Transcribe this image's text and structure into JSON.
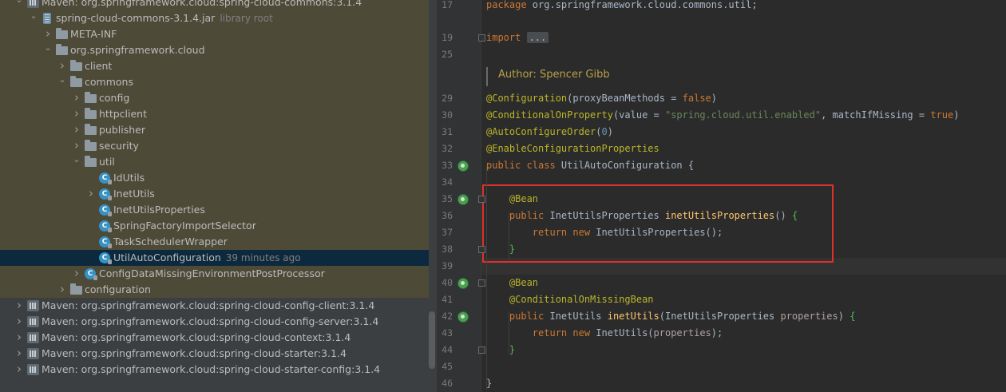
{
  "tree": {
    "rows": [
      {
        "label": "Maven: org.springframework.cloud:spring-cloud-commons:3.1.4",
        "meta": "",
        "icon": "maven",
        "arrow": "down"
      },
      {
        "label": "spring-cloud-commons-3.1.4.jar",
        "meta": "library root",
        "icon": "jar",
        "arrow": "down"
      },
      {
        "label": "META-INF",
        "meta": "",
        "icon": "folder",
        "arrow": "right"
      },
      {
        "label": "org.springframework.cloud",
        "meta": "",
        "icon": "folder",
        "arrow": "down"
      },
      {
        "label": "client",
        "meta": "",
        "icon": "folder",
        "arrow": "right"
      },
      {
        "label": "commons",
        "meta": "",
        "icon": "folder",
        "arrow": "down"
      },
      {
        "label": "config",
        "meta": "",
        "icon": "folder",
        "arrow": "right"
      },
      {
        "label": "httpclient",
        "meta": "",
        "icon": "folder",
        "arrow": "right"
      },
      {
        "label": "publisher",
        "meta": "",
        "icon": "folder",
        "arrow": "right"
      },
      {
        "label": "security",
        "meta": "",
        "icon": "folder",
        "arrow": "right"
      },
      {
        "label": "util",
        "meta": "",
        "icon": "folder",
        "arrow": "down"
      },
      {
        "label": "IdUtils",
        "meta": "",
        "icon": "class",
        "arrow": ""
      },
      {
        "label": "InetUtils",
        "meta": "",
        "icon": "class",
        "arrow": "right"
      },
      {
        "label": "InetUtilsProperties",
        "meta": "",
        "icon": "class",
        "arrow": ""
      },
      {
        "label": "SpringFactoryImportSelector",
        "meta": "",
        "icon": "class",
        "arrow": ""
      },
      {
        "label": "TaskSchedulerWrapper",
        "meta": "",
        "icon": "class",
        "arrow": ""
      },
      {
        "label": "UtilAutoConfiguration",
        "meta": "39 minutes ago",
        "icon": "class",
        "arrow": ""
      },
      {
        "label": "ConfigDataMissingEnvironmentPostProcessor",
        "meta": "",
        "icon": "class",
        "arrow": "right"
      },
      {
        "label": "configuration",
        "meta": "",
        "icon": "folder",
        "arrow": "right"
      },
      {
        "label": "Maven: org.springframework.cloud:spring-cloud-config-client:3.1.4",
        "meta": "",
        "icon": "maven",
        "arrow": "right"
      },
      {
        "label": "Maven: org.springframework.cloud:spring-cloud-config-server:3.1.4",
        "meta": "",
        "icon": "maven",
        "arrow": "right"
      },
      {
        "label": "Maven: org.springframework.cloud:spring-cloud-context:3.1.4",
        "meta": "",
        "icon": "maven",
        "arrow": "right"
      },
      {
        "label": "Maven: org.springframework.cloud:spring-cloud-starter:3.1.4",
        "meta": "",
        "icon": "maven",
        "arrow": "right"
      },
      {
        "label": "Maven: org.springframework.cloud:spring-cloud-starter-config:3.1.4",
        "meta": "",
        "icon": "maven",
        "arrow": "right"
      }
    ],
    "selected_label": "UtilAutoConfiguration"
  },
  "editor": {
    "author_hint": "Author: Spencer Gibb",
    "lines": [
      {
        "n": "17",
        "tokens": [
          [
            "kw",
            "package "
          ],
          [
            "par",
            "org.springframework.cloud.commons.util;"
          ]
        ]
      },
      {
        "n": "19",
        "tokens": [
          [
            "kw",
            "import "
          ],
          [
            "folded",
            "..."
          ]
        ]
      },
      {
        "n": "25",
        "tokens": []
      },
      {
        "n": "29",
        "tokens": [
          [
            "an",
            "@Configuration"
          ],
          [
            "par",
            "(proxyBeanMethods = "
          ],
          [
            "kw",
            "false"
          ],
          [
            "par",
            ")"
          ]
        ]
      },
      {
        "n": "30",
        "tokens": [
          [
            "an",
            "@ConditionalOnProperty"
          ],
          [
            "par",
            "(value = "
          ],
          [
            "st",
            "\"spring.cloud.util.enabled\""
          ],
          [
            "par",
            ", matchIfMissing = "
          ],
          [
            "kw",
            "true"
          ],
          [
            "par",
            ")"
          ]
        ]
      },
      {
        "n": "31",
        "tokens": [
          [
            "an",
            "@AutoConfigureOrder"
          ],
          [
            "par",
            "("
          ],
          [
            "num",
            "0"
          ],
          [
            "par",
            ")"
          ]
        ]
      },
      {
        "n": "32",
        "tokens": [
          [
            "an",
            "@EnableConfigurationProperties"
          ]
        ]
      },
      {
        "n": "33",
        "tokens": [
          [
            "kw",
            "public class "
          ],
          [
            "par",
            "UtilAutoConfiguration {"
          ]
        ]
      },
      {
        "n": "34",
        "tokens": []
      },
      {
        "n": "35",
        "tokens": [
          [
            "par",
            "    "
          ],
          [
            "an",
            "@Bean"
          ]
        ]
      },
      {
        "n": "36",
        "tokens": [
          [
            "par",
            "    "
          ],
          [
            "kw",
            "public "
          ],
          [
            "par",
            "InetUtilsProperties "
          ],
          [
            "fn",
            "inetUtilsProperties"
          ],
          [
            "par",
            "() "
          ],
          [
            "br-g",
            "{"
          ]
        ]
      },
      {
        "n": "37",
        "tokens": [
          [
            "par",
            "        "
          ],
          [
            "kw",
            "return new "
          ],
          [
            "par",
            "InetUtilsProperties();"
          ]
        ]
      },
      {
        "n": "38",
        "tokens": [
          [
            "par",
            "    "
          ],
          [
            "br-g",
            "}"
          ]
        ]
      },
      {
        "n": "39",
        "tokens": []
      },
      {
        "n": "40",
        "tokens": [
          [
            "par",
            "    "
          ],
          [
            "an",
            "@Bean"
          ]
        ]
      },
      {
        "n": "41",
        "tokens": [
          [
            "par",
            "    "
          ],
          [
            "an",
            "@ConditionalOnMissingBean"
          ]
        ]
      },
      {
        "n": "42",
        "tokens": [
          [
            "par",
            "    "
          ],
          [
            "kw",
            "public "
          ],
          [
            "par",
            "InetUtils "
          ],
          [
            "fn",
            "inetUtils"
          ],
          [
            "par",
            "(InetUtilsProperties "
          ],
          [
            "pv",
            "properties"
          ],
          [
            "par",
            ") "
          ],
          [
            "br-g",
            "{"
          ]
        ]
      },
      {
        "n": "43",
        "tokens": [
          [
            "par",
            "        "
          ],
          [
            "kw",
            "return new "
          ],
          [
            "par",
            "InetUtils("
          ],
          [
            "pv",
            "properties"
          ],
          [
            "par",
            ");"
          ]
        ]
      },
      {
        "n": "44",
        "tokens": [
          [
            "par",
            "    "
          ],
          [
            "br-g",
            "}"
          ]
        ]
      },
      {
        "n": "45",
        "tokens": []
      },
      {
        "n": "46",
        "tokens": [
          [
            "par",
            "}"
          ]
        ]
      }
    ]
  }
}
